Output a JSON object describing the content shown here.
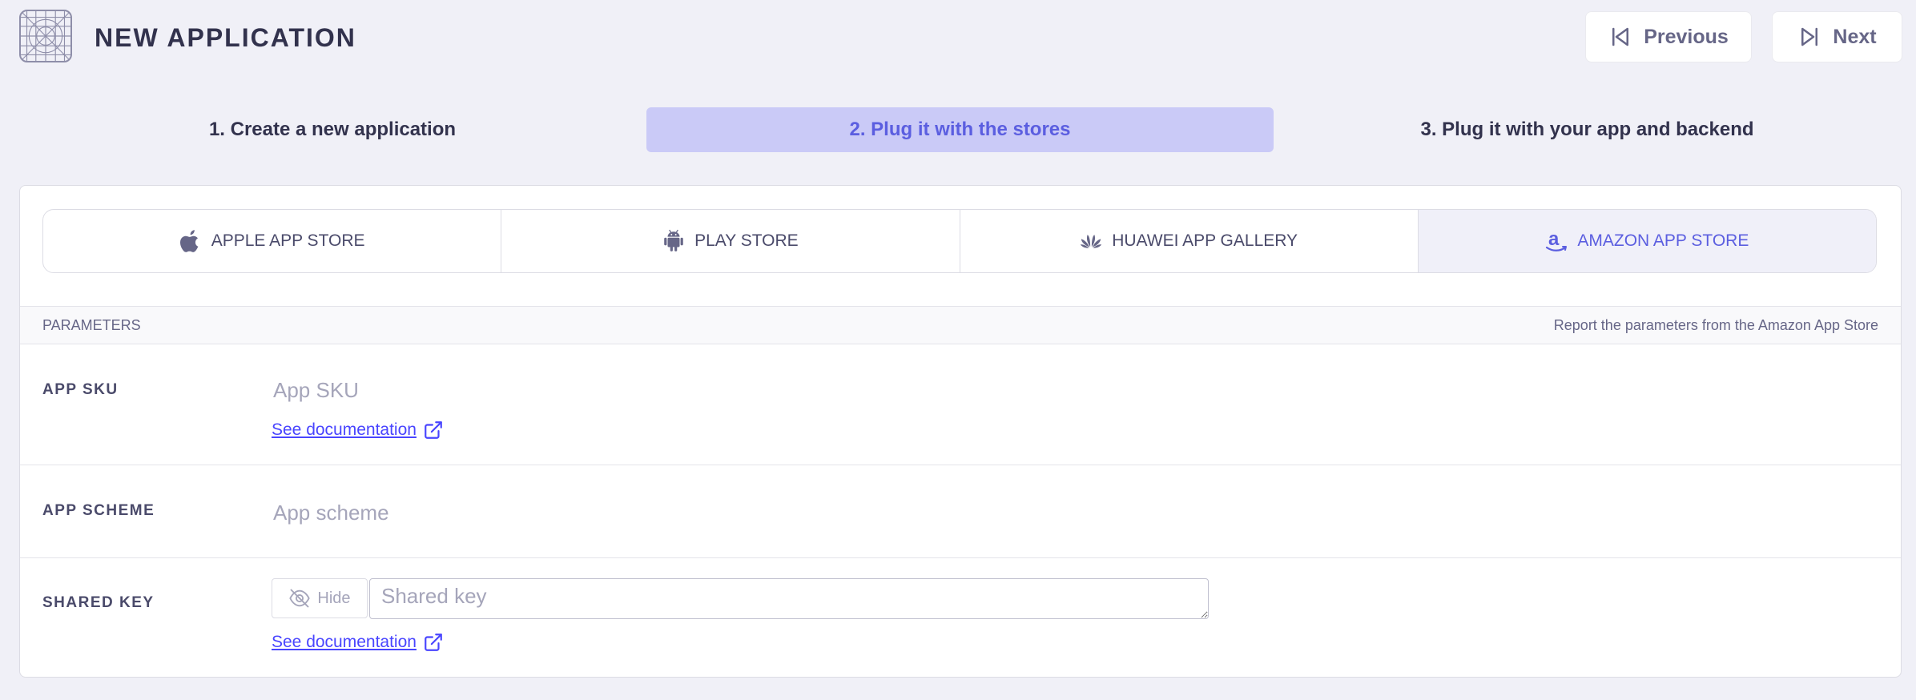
{
  "header": {
    "title": "NEW APPLICATION",
    "previous_label": "Previous",
    "next_label": "Next"
  },
  "steps": [
    {
      "label": "1. Create a new application",
      "active": false
    },
    {
      "label": "2. Plug it with the stores",
      "active": true
    },
    {
      "label": "3. Plug it with your app and backend",
      "active": false
    }
  ],
  "store_tabs": [
    {
      "label": "APPLE APP STORE",
      "icon": "apple-icon",
      "active": false
    },
    {
      "label": "PLAY STORE",
      "icon": "android-icon",
      "active": false
    },
    {
      "label": "HUAWEI APP GALLERY",
      "icon": "huawei-icon",
      "active": false
    },
    {
      "label": "AMAZON APP STORE",
      "icon": "amazon-icon",
      "active": true
    }
  ],
  "parameters": {
    "label": "PARAMETERS",
    "hint": "Report the parameters from the Amazon App Store"
  },
  "fields": {
    "app_sku": {
      "label": "APP SKU",
      "placeholder": "App SKU",
      "doc_link": "See documentation"
    },
    "app_scheme": {
      "label": "APP SCHEME",
      "placeholder": "App scheme"
    },
    "shared_key": {
      "label": "SHARED KEY",
      "placeholder": "Shared key",
      "hide_label": "Hide",
      "doc_link": "See documentation"
    }
  },
  "colors": {
    "accent": "#5b5ee0",
    "active_step_bg": "#cacaf7",
    "link": "#4945ff",
    "background": "#f0f0f7"
  }
}
